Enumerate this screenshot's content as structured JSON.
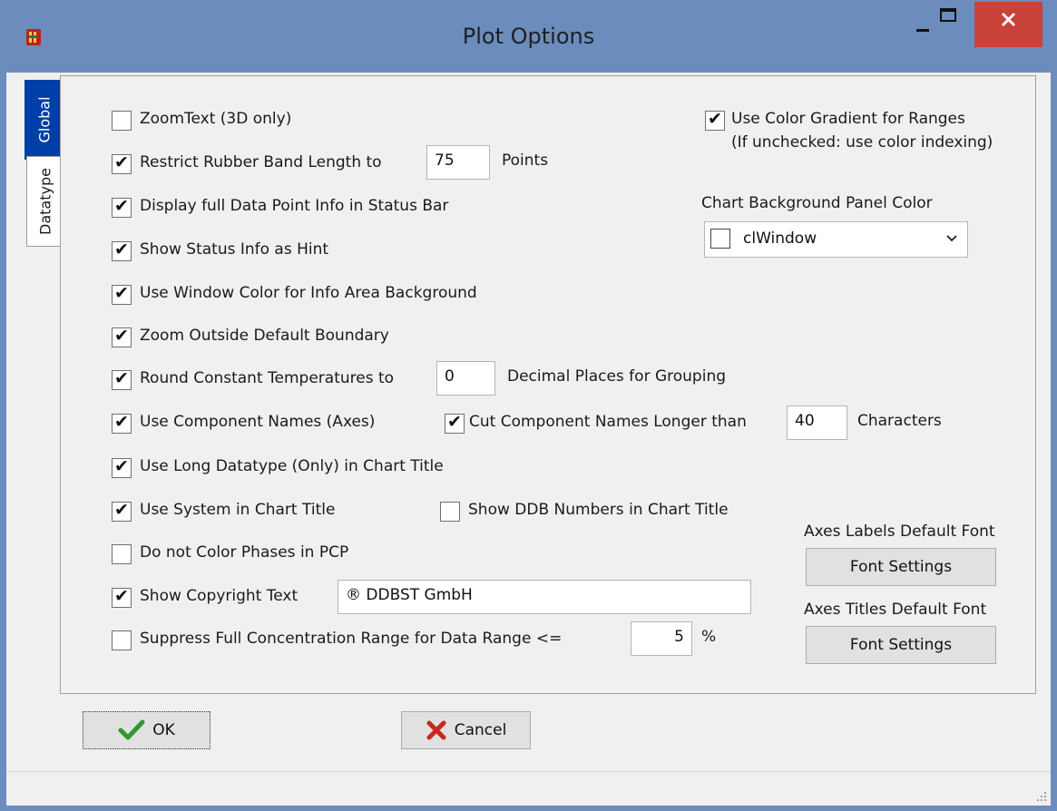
{
  "window": {
    "title": "Plot Options",
    "colors": {
      "titlebar": "#6b8cbc",
      "close": "#c8423a",
      "active_tab": "#003ea8"
    }
  },
  "tabs": [
    {
      "label": "Global",
      "active": true
    },
    {
      "label": "Datatype",
      "active": false
    }
  ],
  "options": {
    "zoomtext": {
      "label": "ZoomText (3D only)",
      "checked": false
    },
    "restrict_rubber": {
      "label": "Restrict Rubber Band Length to",
      "checked": true,
      "value": "75",
      "suffix": "Points"
    },
    "display_full_info": {
      "label": "Display full Data Point Info in Status Bar",
      "checked": true
    },
    "status_hint": {
      "label": "Show Status Info as Hint",
      "checked": true
    },
    "window_color": {
      "label": "Use Window Color for Info Area Background",
      "checked": true
    },
    "zoom_outside": {
      "label": "Zoom Outside Default Boundary",
      "checked": true
    },
    "round_temps": {
      "label": "Round Constant Temperatures to",
      "checked": true,
      "value": "0",
      "suffix": "Decimal Places for Grouping"
    },
    "component_names": {
      "label": "Use Component Names (Axes)",
      "checked": true
    },
    "cut_names": {
      "label": "Cut Component Names Longer than",
      "checked": true,
      "value": "40",
      "suffix": "Characters"
    },
    "long_datatype": {
      "label": "Use Long Datatype (Only) in Chart Title",
      "checked": true
    },
    "system_title": {
      "label": "Use System in Chart Title",
      "checked": true
    },
    "ddb_numbers": {
      "label": "Show DDB Numbers in Chart Title",
      "checked": false
    },
    "no_color_phases": {
      "label": "Do not Color Phases in PCP",
      "checked": false
    },
    "copyright": {
      "label": "Show Copyright Text",
      "checked": true,
      "value": "® DDBST GmbH"
    },
    "suppress_range": {
      "label": "Suppress Full Concentration Range for Data Range <=",
      "checked": false,
      "value": "5",
      "suffix": "%"
    },
    "color_gradient": {
      "label": "Use Color Gradient for Ranges",
      "checked": true,
      "note": "(If unchecked: use color indexing)"
    }
  },
  "chart_bg": {
    "label": "Chart Background Panel Color",
    "selected": "clWindow"
  },
  "fonts": {
    "axes_labels": {
      "label": "Axes Labels Default Font",
      "button": "Font Settings"
    },
    "axes_titles": {
      "label": "Axes Titles Default Font",
      "button": "Font Settings"
    }
  },
  "buttons": {
    "ok": "OK",
    "cancel": "Cancel"
  }
}
